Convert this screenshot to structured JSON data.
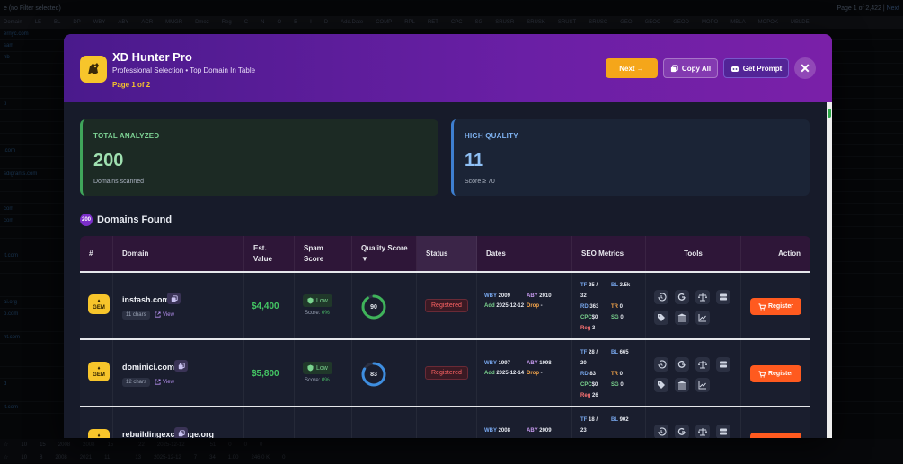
{
  "background": {
    "filter_text": "e (no Filter selected)",
    "pager_text": "Page 1 of 2,422",
    "pager_link": "Next",
    "columns": [
      "Domain",
      "LE",
      "BL",
      "DP",
      "WBY",
      "ABY",
      "ACR",
      "MMGR",
      "Dmoz",
      "Reg",
      "C",
      "N",
      "O",
      "B",
      "I",
      "D",
      "Add.Date",
      "COMP",
      "RPL",
      "RET",
      "CPC",
      "SG",
      "SRUSR",
      "SRUSK",
      "SRUST",
      "SRUSC",
      "GEO",
      "GEOC",
      "GEOD",
      "MOPO",
      "MBLA",
      "MOPOK",
      "MBLDE"
    ],
    "rows": [
      "ernyc.com",
      "sam",
      "nb",
      "",
      "",
      "",
      "",
      "",
      "",
      "",
      "ti",
      "",
      "",
      "",
      "",
      "",
      "sdigrants.com",
      "",
      "",
      "",
      "",
      "",
      "",
      "",
      "d",
      "",
      "",
      "",
      "",
      "",
      "",
      "",
      "",
      "",
      "",
      "",
      "",
      "",
      "",
      "",
      "",
      "",
      "",
      "",
      "",
      "",
      "",
      "",
      "",
      "",
      "",
      "",
      "",
      "",
      "",
      "",
      "",
      "",
      "",
      "",
      "",
      "",
      "",
      ""
    ],
    "side_rows": [
      "ernyc.com",
      "sam",
      "nb",
      "",
      "",
      "",
      "ti",
      "",
      "",
      "",
      ".com",
      "",
      "sdigrants.com",
      "",
      "",
      "com",
      "com",
      "",
      "",
      "it.com",
      "",
      "",
      "",
      "ai.org",
      "o.com",
      "",
      "ht.com",
      "",
      "",
      "",
      "d",
      "",
      "it.com",
      "",
      "",
      "org",
      "",
      "",
      "or.com",
      "",
      "om",
      "ance.com",
      "",
      "",
      "org"
    ],
    "bottom_rows": [
      {
        "cells": [
          "10",
          "15",
          "2008",
          "2008",
          "15",
          "",
          "22",
          "2025-12-12",
          "",
          "51",
          "0",
          "0",
          "0"
        ]
      },
      {
        "cells": [
          "10",
          "8",
          "2008",
          "2021",
          "11",
          "",
          "13",
          "2025-12-12",
          "7",
          "34",
          "1.00",
          "246.0 K",
          "0"
        ]
      }
    ]
  },
  "modal": {
    "title": "XD Hunter Pro",
    "subtitle": "Professional Selection • Top Domain In Table",
    "page": "Page 1 of 2",
    "buttons": {
      "next": "Next →",
      "copy_all": "Copy All",
      "get_prompt": "Get Prompt",
      "close": "✕"
    },
    "cards": {
      "total": {
        "label": "TOTAL ANALYZED",
        "value": "200",
        "note": "Domains scanned"
      },
      "hq": {
        "label": "HIGH QUALITY",
        "value": "11",
        "note": "Score ≥ 70"
      }
    },
    "found": {
      "count": "200",
      "label": "Domains Found"
    },
    "table": {
      "headers": {
        "num": "#",
        "domain": "Domain",
        "est1": "Est.",
        "est2": "Value",
        "spam1": "Spam",
        "spam2": "Score",
        "quality1": "Quality Score",
        "quality2": "▼",
        "status": "Status",
        "dates": "Dates",
        "seo": "SEO Metrics",
        "tools": "Tools",
        "action": "Action"
      },
      "rows": [
        {
          "badge": "GEM",
          "domain": "instash.com",
          "chars": "11 chars",
          "view": "View",
          "value": "$4,400",
          "spam": "Low",
          "spam_label": "Score:",
          "spam_score": "0%",
          "quality": "90",
          "quality_pct": 90,
          "quality_color": "#3fb35a",
          "status": "Registered",
          "wby_k": "WBY",
          "wby": "2009",
          "aby_k": "ABY",
          "aby": "2010",
          "add_k": "Add",
          "add": "2025-12-12",
          "drop_k": "Drop",
          "drop": "-",
          "tf_k": "TF",
          "tf": "25",
          "tf2": "32",
          "bl_k": "BL",
          "bl": "3.5k",
          "rd_k": "RD",
          "rd": "363",
          "tr_k": "TR",
          "tr": "0",
          "cpc_k": "CPC",
          "cpc": "$0",
          "sg_k": "SG",
          "sg": "0",
          "reg_k": "Reg",
          "reg": "3",
          "action": "Register"
        },
        {
          "badge": "GEM",
          "domain": "dominici.com",
          "chars": "12 chars",
          "view": "View",
          "value": "$5,800",
          "spam": "Low",
          "spam_label": "Score:",
          "spam_score": "0%",
          "quality": "83",
          "quality_pct": 83,
          "quality_color": "#3e8ee0",
          "status": "Registered",
          "wby_k": "WBY",
          "wby": "1997",
          "aby_k": "ABY",
          "aby": "1998",
          "add_k": "Add",
          "add": "2025-12-14",
          "drop_k": "Drop",
          "drop": "-",
          "tf_k": "TF",
          "tf": "28",
          "tf2": "20",
          "bl_k": "BL",
          "bl": "665",
          "rd_k": "RD",
          "rd": "83",
          "tr_k": "TR",
          "tr": "0",
          "cpc_k": "CPC",
          "cpc": "$0",
          "sg_k": "SG",
          "sg": "0",
          "reg_k": "Reg",
          "reg": "26",
          "action": "Register"
        },
        {
          "badge": "GEM",
          "domain": "rebuildingexchange.org",
          "chars": "",
          "view": "",
          "value": "",
          "spam": "",
          "spam_label": "",
          "spam_score": "",
          "quality": "",
          "quality_pct": 0,
          "quality_color": "#3e8ee0",
          "status": "",
          "wby_k": "WBY",
          "wby": "2008",
          "aby_k": "ABY",
          "aby": "2009",
          "add_k": "",
          "add": "",
          "drop_k": "",
          "drop": "",
          "tf_k": "TF",
          "tf": "18",
          "tf2": "23",
          "bl_k": "BL",
          "bl": "902",
          "rd_k": "",
          "rd": "",
          "tr_k": "",
          "tr": "",
          "cpc_k": "",
          "cpc": "",
          "sg_k": "",
          "sg": "",
          "reg_k": "",
          "reg": "",
          "action": "Register"
        }
      ]
    }
  }
}
